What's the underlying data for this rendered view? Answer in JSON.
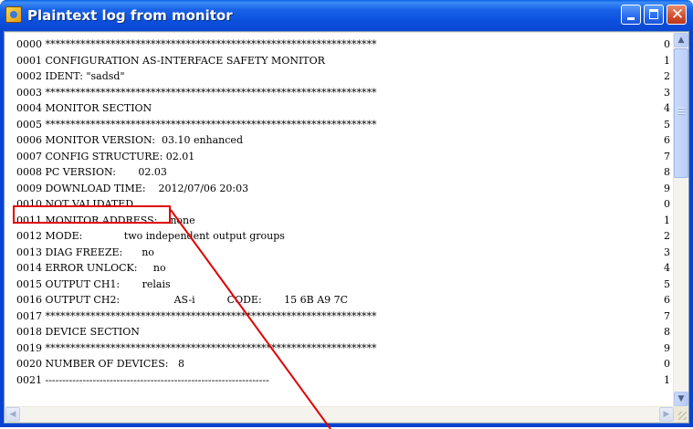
{
  "window": {
    "title": "Plaintext log from monitor",
    "icon": "application-icon"
  },
  "controls": {
    "minimize_icon": "minimize-icon",
    "maximize_icon": "maximize-icon",
    "close_icon": "close-icon",
    "close_glyph": "✕"
  },
  "log": {
    "lines": [
      "0000 ******************************************************************",
      "0001 CONFIGURATION AS-INTERFACE SAFETY MONITOR",
      "0002 IDENT: \"sadsd\"",
      "0003 ******************************************************************",
      "0004 MONITOR SECTION",
      "0005 ******************************************************************",
      "0006 MONITOR VERSION:  03.10 enhanced",
      "0007 CONFIG STRUCTURE: 02.01",
      "0008 PC VERSION:       02.03",
      "0009 DOWNLOAD TIME:    2012/07/06 20:03",
      "0010 NOT VALIDATED",
      "0011 MONITOR ADDRESS:    none",
      "0012 MODE:             two independent output groups",
      "0013 DIAG FREEZE:      no",
      "0014 ERROR UNLOCK:     no",
      "0015 OUTPUT CH1:       relais",
      "0016 OUTPUT CH2:                 AS-i          CODE:       15 6B A9 7C",
      "0017 ******************************************************************",
      "0018 DEVICE SECTION",
      "0019 ******************************************************************",
      "0020 NUMBER OF DEVICES:   8",
      "0021 ------------------------------------------------------------------"
    ],
    "checksums": [
      "0",
      "1",
      "2",
      "3",
      "4",
      "5",
      "6",
      "7",
      "8",
      "9",
      "0",
      "1",
      "2",
      "3",
      "4",
      "5",
      "6",
      "7",
      "8",
      "9",
      "0",
      "1"
    ]
  },
  "scrollbars": {
    "up_arrow": "▲",
    "down_arrow": "▼",
    "left_arrow": "◀",
    "right_arrow": "▶"
  },
  "annotation": {
    "highlighted_text": "0010 NOT VALIDATED",
    "color": "#e00000"
  },
  "colors": {
    "titlebar": "#0a47cf",
    "title_text": "#ffffff",
    "close_button": "#d2502e",
    "text_background": "#ffffff"
  }
}
